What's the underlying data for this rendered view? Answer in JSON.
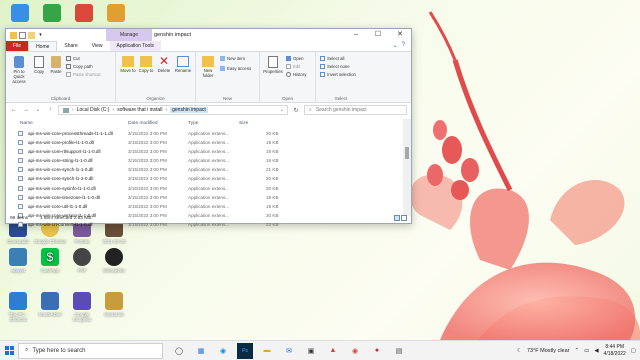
{
  "window": {
    "title": "genshin impact",
    "manage_tab": "Manage",
    "app_tools_tab": "Application Tools",
    "tabs": [
      "File",
      "Home",
      "Share",
      "View"
    ]
  },
  "ribbon": {
    "clipboard": {
      "label": "Clipboard",
      "pin": "Pin to Quick access",
      "copy": "Copy",
      "paste": "Paste",
      "cut": "Cut",
      "copy_path": "Copy path",
      "paste_shortcut": "Paste shortcut"
    },
    "organize": {
      "label": "Organize",
      "move_to": "Move to",
      "copy_to": "Copy to",
      "delete": "Delete",
      "rename": "Rename"
    },
    "new": {
      "label": "New",
      "new_folder": "New folder",
      "new_item": "New item",
      "easy_access": "Easy access"
    },
    "open": {
      "label": "Open",
      "properties": "Properties",
      "open": "Open",
      "edit": "Edit",
      "history": "History"
    },
    "select": {
      "label": "Select",
      "select_all": "Select all",
      "select_none": "Select none",
      "invert": "Invert selection"
    }
  },
  "address": {
    "segments": [
      "Local Disk (C:)",
      "software that i install",
      "genshin impact"
    ],
    "search_placeholder": "Search genshin impact"
  },
  "columns": {
    "name": "Name",
    "date": "Date modified",
    "type": "Type",
    "size": "Size"
  },
  "files": [
    {
      "name": "api-ms-win-core-processthreads-l1-1-1.dll",
      "date": "3/15/2022 3:00 PM",
      "type": "Application extens...",
      "size": "20 KB"
    },
    {
      "name": "api-ms-win-core-profile-l1-1-0.dll",
      "date": "3/15/2022 3:00 PM",
      "type": "Application extens...",
      "size": "19 KB"
    },
    {
      "name": "api-ms-win-core-rtlsupport-l1-1-0.dll",
      "date": "3/15/2022 3:00 PM",
      "type": "Application extens...",
      "size": "19 KB"
    },
    {
      "name": "api-ms-win-core-string-l1-1-0.dll",
      "date": "3/15/2022 3:00 PM",
      "type": "Application extens...",
      "size": "19 KB"
    },
    {
      "name": "api-ms-win-core-synch-l1-1-0.dll",
      "date": "3/15/2022 3:00 PM",
      "type": "Application extens...",
      "size": "21 KB"
    },
    {
      "name": "api-ms-win-core-synch-l1-2-0.dll",
      "date": "3/15/2022 3:00 PM",
      "type": "Application extens...",
      "size": "20 KB"
    },
    {
      "name": "api-ms-win-core-sysinfo-l1-1-0.dll",
      "date": "3/15/2022 3:00 PM",
      "type": "Application extens...",
      "size": "20 KB"
    },
    {
      "name": "api-ms-win-core-timezone-l1-1-0.dll",
      "date": "3/15/2022 3:00 PM",
      "type": "Application extens...",
      "size": "19 KB"
    },
    {
      "name": "api-ms-win-core-util-l1-1-0.dll",
      "date": "3/15/2022 3:00 PM",
      "type": "Application extens...",
      "size": "19 KB"
    },
    {
      "name": "api-ms-win-core-version-l1-1-0.dll",
      "date": "3/15/2022 3:00 PM",
      "type": "Application extens...",
      "size": "20 KB"
    },
    {
      "name": "api-ms-win-crt-convert-l1-1-0.dll",
      "date": "3/15/2022 3:00 PM",
      "type": "Application extens...",
      "size": "23 KB"
    }
  ],
  "status": {
    "items": "96 items",
    "selected": "1 item selected  2.83 MB"
  },
  "desktop": {
    "icons": [
      {
        "label": "",
        "color": "#3a8ee6"
      },
      {
        "label": "",
        "color": "#37a447"
      },
      {
        "label": "",
        "color": "#d9483b"
      },
      {
        "label": "",
        "color": "#e0a030"
      },
      {
        "label": "Ocenaudio",
        "color": "#2b4b8c"
      },
      {
        "label": "Google Chrome",
        "color": "#e8c34a"
      },
      {
        "label": "Fortnite",
        "color": "#7a5a9a"
      },
      {
        "label": "2021-03-30",
        "color": "#6b4e3a"
      },
      {
        "label": "wpsyst",
        "color": "#3b7fb5"
      },
      {
        "label": "CashApp",
        "color": "#00c244"
      },
      {
        "label": "FNF",
        "color": "#444444"
      },
      {
        "label": "Wikrawhite",
        "color": "#222222"
      },
      {
        "label": "This PC - Shortcut",
        "color": "#2f7dd1"
      },
      {
        "label": "bnetNADiel",
        "color": "#3b6fb5"
      },
      {
        "label": "Google Incognito",
        "color": "#5b4bb5"
      },
      {
        "label": "Medal.lnk",
        "color": "#c89b3c"
      }
    ]
  },
  "taskbar": {
    "search_placeholder": "Type here to search",
    "weather": "73°F  Mostly clear",
    "time": "8:44 PM",
    "date": "4/18/2022"
  },
  "colors": {
    "file_tab": "#c42b1c",
    "manage_tab": "#d7c8ee",
    "accent": "#1e6fd9",
    "selection": "#cce4f7"
  }
}
